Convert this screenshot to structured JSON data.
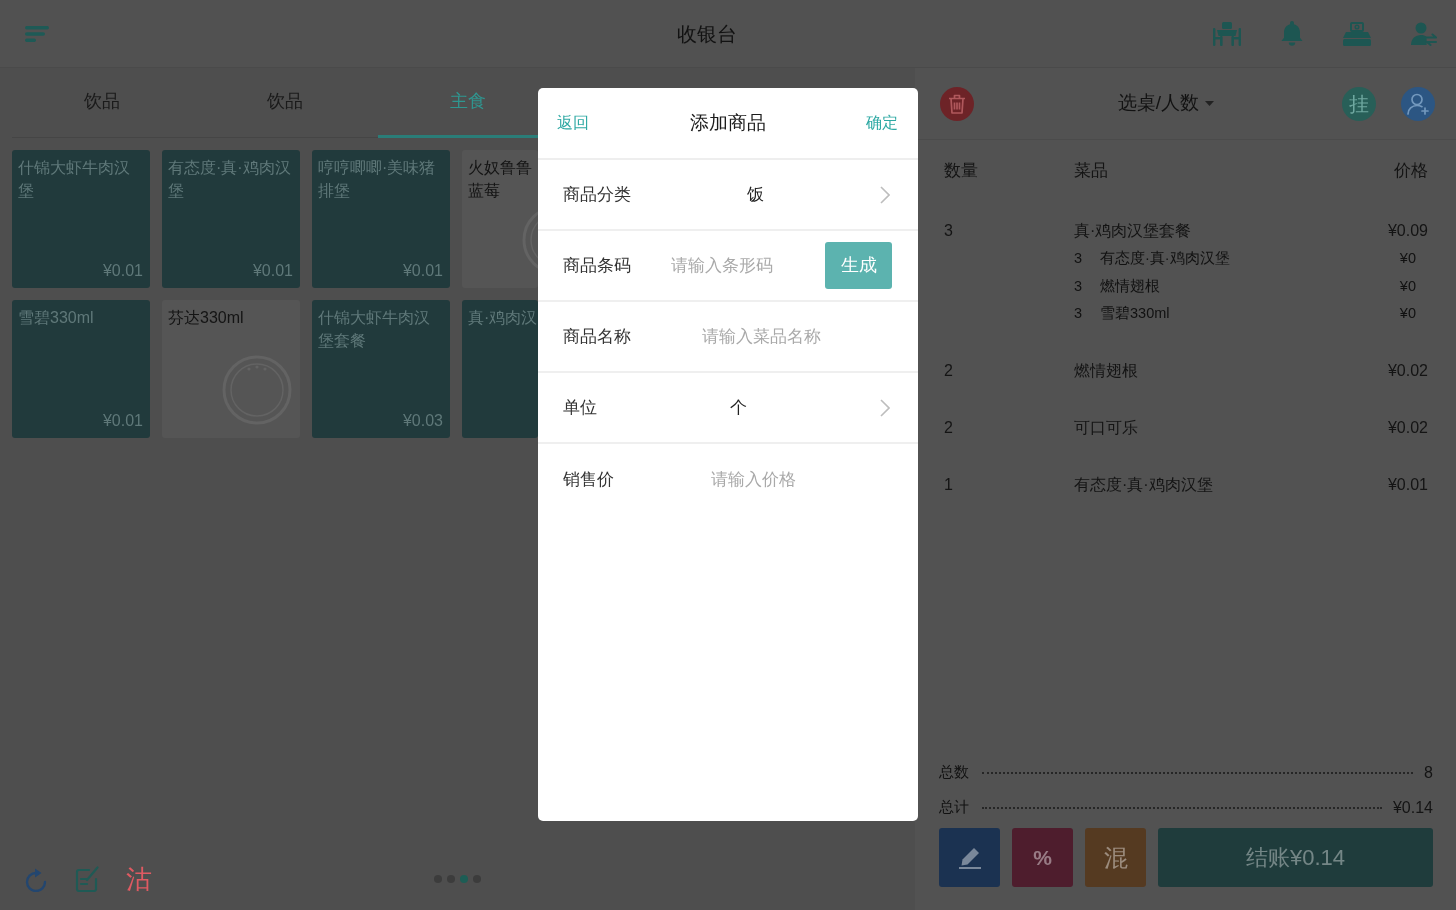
{
  "header": {
    "title": "收银台"
  },
  "category_tabs": [
    {
      "label": "饮品",
      "selected": false
    },
    {
      "label": "饮品",
      "selected": false
    },
    {
      "label": "主食",
      "selected": true
    }
  ],
  "products": [
    {
      "name": "什锦大虾牛肉汉堡",
      "price": "¥0.01",
      "sold_out": false
    },
    {
      "name": "有态度·真·鸡肉汉堡",
      "price": "¥0.01",
      "sold_out": false
    },
    {
      "name": "哼哼唧唧·美味猪排堡",
      "price": "¥0.01",
      "sold_out": false
    },
    {
      "name": "火奴鲁鲁蓝莓",
      "sold_out": true
    },
    {
      "name": "雪碧330ml",
      "price": "¥0.01",
      "sold_out": false
    },
    {
      "name": "芬达330ml",
      "sold_out": true
    },
    {
      "name": "什锦大虾牛肉汉堡套餐",
      "price": "¥0.03",
      "sold_out": false
    },
    {
      "name": "真·鸡肉汉",
      "sold_out": false
    }
  ],
  "toolbar": {
    "sold_out_label": "沽"
  },
  "pager": [
    {
      "selected": false
    },
    {
      "selected": false
    },
    {
      "selected": true
    },
    {
      "selected": false
    }
  ],
  "order": {
    "table_selector": "选桌/人数",
    "hold_label": "挂",
    "columns": [
      "数量",
      "菜品",
      "价格"
    ],
    "rows": [
      {
        "qty": "3",
        "name": "真·鸡肉汉堡套餐",
        "price": "¥0.09",
        "children": [
          {
            "qty": "3",
            "name": "有态度·真·鸡肉汉堡",
            "price": "¥0"
          },
          {
            "qty": "3",
            "name": "燃情翅根",
            "price": "¥0"
          },
          {
            "qty": "3",
            "name": "雪碧330ml",
            "price": "¥0"
          }
        ]
      },
      {
        "qty": "2",
        "name": "燃情翅根",
        "price": "¥0.02"
      },
      {
        "qty": "2",
        "name": "可口可乐",
        "price": "¥0.02"
      },
      {
        "qty": "1",
        "name": "有态度·真·鸡肉汉堡",
        "price": "¥0.01"
      }
    ],
    "totals": [
      {
        "label": "总数",
        "value": "8"
      },
      {
        "label": "总计",
        "value": "¥0.14"
      }
    ],
    "actions": [
      {
        "kind": "edit"
      },
      {
        "kind": "discount",
        "label": "%"
      },
      {
        "kind": "mixed",
        "label": "混"
      },
      {
        "kind": "checkout",
        "label": "结账¥0.14"
      }
    ]
  },
  "dialog": {
    "back": "返回",
    "title": "添加商品",
    "confirm": "确定",
    "fields": [
      {
        "kind": "select",
        "label": "商品分类",
        "value": "饭"
      },
      {
        "kind": "input",
        "label": "商品条码",
        "placeholder": "请输入条形码",
        "button": "生成"
      },
      {
        "kind": "input",
        "label": "商品名称",
        "placeholder": "请输入菜品名称"
      },
      {
        "kind": "select",
        "label": "单位",
        "value": "个"
      },
      {
        "kind": "input",
        "label": "销售价",
        "placeholder": "请输入价格"
      }
    ]
  }
}
